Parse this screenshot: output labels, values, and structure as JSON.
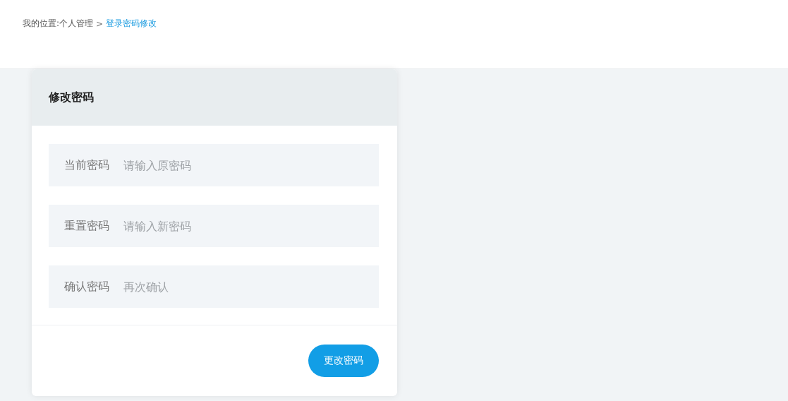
{
  "breadcrumb": {
    "prefix": "我的位置:个人管理",
    "separator": ">",
    "current": "登录密码修改"
  },
  "panel": {
    "title": "修改密码",
    "fields": [
      {
        "label": "当前密码",
        "placeholder": "请输入原密码"
      },
      {
        "label": "重置密码",
        "placeholder": "请输入新密码"
      },
      {
        "label": "确认密码",
        "placeholder": "再次确认"
      }
    ],
    "submit": "更改密码"
  }
}
